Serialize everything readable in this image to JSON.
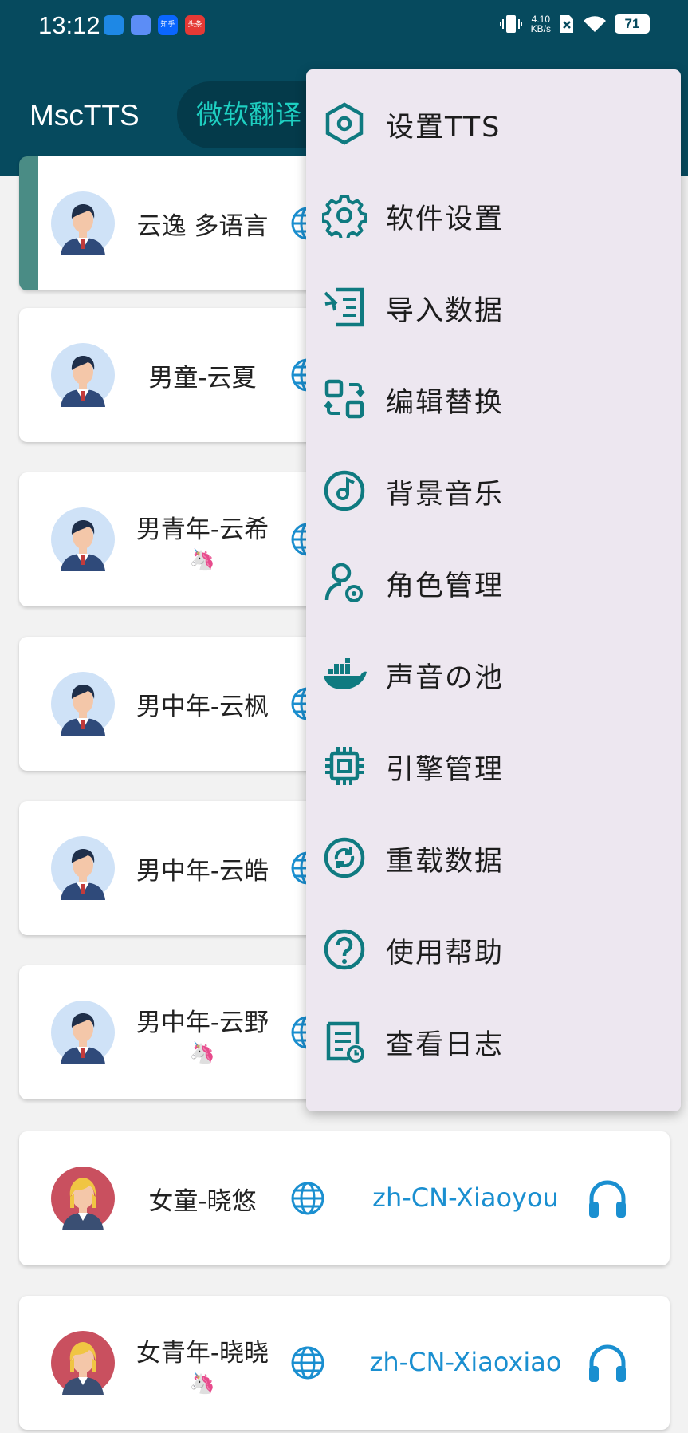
{
  "status_bar": {
    "time": "13:12",
    "app_icons": [
      {
        "name": "qq-browser-icon",
        "color": "#1e88e5",
        "text": ""
      },
      {
        "name": "baidu-netdisk-icon",
        "color": "#5c8df6",
        "text": ""
      },
      {
        "name": "zhihu-icon",
        "color": "#0a66ff",
        "text": "知乎"
      },
      {
        "name": "toutiao-icon",
        "color": "#e53935",
        "text": "头条"
      }
    ],
    "net_speed_value": "4.10",
    "net_speed_unit": "KB/s",
    "battery": "71"
  },
  "app_bar": {
    "title": "MscTTS",
    "active_tab": "微软翻译"
  },
  "colors": {
    "primary": "#064a5e",
    "accent": "#1ecfc1",
    "teal_icon": "#0f7a80",
    "link_blue": "#1a8fd0",
    "menu_bg": "#ede7f0"
  },
  "voices": [
    {
      "name": "云逸 多语言",
      "gender": "male",
      "emoji": "",
      "id": "",
      "selected": true
    },
    {
      "name": "男童-云夏",
      "gender": "male",
      "emoji": "",
      "id": ""
    },
    {
      "name": "男青年-云希",
      "gender": "male",
      "emoji": "🦄",
      "id": ""
    },
    {
      "name": "男中年-云枫",
      "gender": "male",
      "emoji": "",
      "id": ""
    },
    {
      "name": "男中年-云皓",
      "gender": "male",
      "emoji": "",
      "id": ""
    },
    {
      "name": "男中年-云野",
      "gender": "male",
      "emoji": "🦄",
      "id": ""
    },
    {
      "name": "女童-晓悠",
      "gender": "female",
      "emoji": "",
      "id": "zh-CN-Xiaoyou"
    },
    {
      "name": "女青年-晓晓",
      "gender": "female",
      "emoji": "🦄",
      "id": "zh-CN-Xiaoxiao"
    }
  ],
  "menu": {
    "items": [
      {
        "label": "设置TTS",
        "icon": "hexagon-settings-icon"
      },
      {
        "label": "软件设置",
        "icon": "gear-icon"
      },
      {
        "label": "导入数据",
        "icon": "import-icon"
      },
      {
        "label": "编辑替换",
        "icon": "replace-icon"
      },
      {
        "label": "背景音乐",
        "icon": "music-disc-icon"
      },
      {
        "label": "角色管理",
        "icon": "user-settings-icon"
      },
      {
        "label": "声音の池",
        "icon": "docker-whale-icon"
      },
      {
        "label": "引擎管理",
        "icon": "chip-icon"
      },
      {
        "label": "重载数据",
        "icon": "refresh-icon"
      },
      {
        "label": "使用帮助",
        "icon": "help-icon"
      },
      {
        "label": "查看日志",
        "icon": "log-icon"
      }
    ]
  }
}
